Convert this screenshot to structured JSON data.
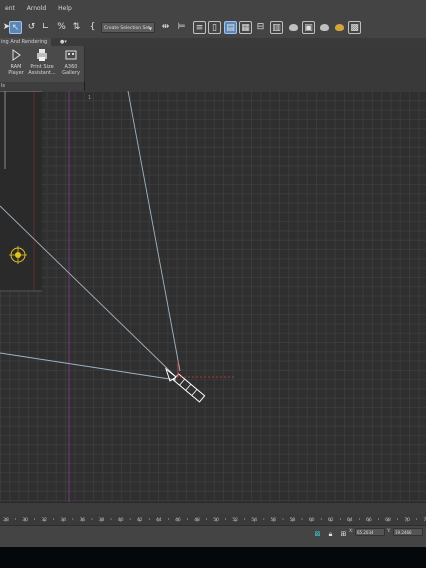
{
  "menu": {
    "items": [
      "ent",
      "Arnold",
      "Help"
    ]
  },
  "toolbar": {
    "selection_set_placeholder": "Create Selection Set"
  },
  "ribbon": {
    "tab_label": "ing And Rendering",
    "buttons": [
      {
        "line1": "RAM",
        "line2": "Player"
      },
      {
        "line1": "Print Size",
        "line2": "Assistant..."
      },
      {
        "line1": "A360",
        "line2": "Gallery"
      }
    ],
    "panel_label": "ls"
  },
  "viewport": {
    "label_marker": "1"
  },
  "ruler": {
    "ticks": [
      "28",
      "30",
      "32",
      "34",
      "36",
      "38",
      "40",
      "42",
      "44",
      "46",
      "48",
      "50",
      "52",
      "54",
      "56",
      "58",
      "60",
      "62",
      "64",
      "66",
      "68",
      "70",
      "72"
    ]
  },
  "status": {
    "x_label": "X:",
    "x_value": "65.2034",
    "y_label": "Y:",
    "y_value": "19.2466"
  },
  "colors": {
    "active_tool": "#5b86b8",
    "viewport_bg": "#2f2f2f",
    "frustum_line": "#9fb4c2",
    "light_gizmo": "#e2c21d",
    "axis_red": "#d23a3a",
    "magenta_line": "#a03cb0"
  }
}
